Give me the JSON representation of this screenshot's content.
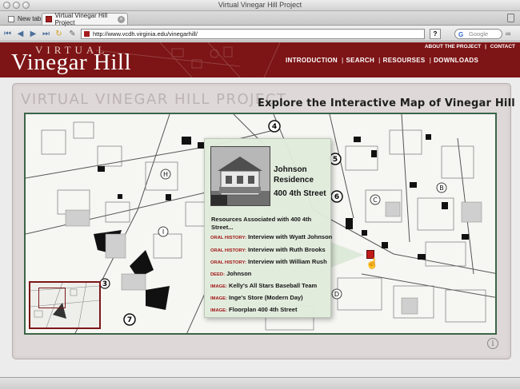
{
  "window": {
    "title": "Virtual Vinegar Hill Project"
  },
  "tabs": [
    {
      "label": "New tab"
    },
    {
      "label": "Virtual Vinegar Hill Project"
    }
  ],
  "toolbar": {
    "url": "http://www.vcdh.virginia.edu/vinegarhill/",
    "help_label": "?",
    "search_placeholder": "Google"
  },
  "header": {
    "virtual": "VIRTUAL",
    "title": "Vinegar Hill",
    "top_links": [
      "ABOUT THE PROJECT",
      "CONTACT"
    ],
    "nav": [
      "INTRODUCTION",
      "SEARCH",
      "RESOURSES",
      "DOWNLOADS"
    ]
  },
  "main": {
    "project_title": "VIRTUAL VINEGAR HILL PROJECT",
    "map_heading": "Explore the Interactive Map of Vinegar Hill"
  },
  "popup": {
    "name": "Johnson Residence",
    "address": "400 4th Street",
    "resources_heading": "Resources Associated with 400 4th Street...",
    "items": [
      {
        "type": "ORAL HISTORY:",
        "label": "Interview with Wyatt Johnson"
      },
      {
        "type": "ORAL HISTORY:",
        "label": "Interview with Ruth Brooks"
      },
      {
        "type": "ORAL HISTORY:",
        "label": "Interview with William Rush"
      },
      {
        "type": "DEED:",
        "label": "Johnson"
      },
      {
        "type": "IMAGE:",
        "label": "Kelly's All Stars Baseball Team"
      },
      {
        "type": "IMAGE:",
        "label": "Inge's Store (Modern Day)"
      },
      {
        "type": "IMAGE:",
        "label": "Floorplan 400 4th Street"
      }
    ]
  },
  "map_labels": {
    "street_numbers": [
      "4",
      "5",
      "6",
      "7",
      "3"
    ],
    "block_letters": [
      "H",
      "I",
      "C",
      "B",
      "D"
    ]
  },
  "info_label": "i",
  "colors": {
    "brand": "#7d1416",
    "map_border": "#3b6548",
    "accent_red": "#a01717"
  }
}
